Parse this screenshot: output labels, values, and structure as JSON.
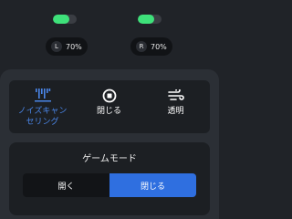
{
  "earbuds": {
    "left": {
      "label": "L",
      "battery_text": "70%",
      "battery_level": 0.7
    },
    "right": {
      "label": "R",
      "battery_text": "70%",
      "battery_level": 0.7
    }
  },
  "colors": {
    "battery_fill": "#3ee17a",
    "accent": "#2f6fe0",
    "active_text": "#4a86e8"
  },
  "anc_modes": {
    "items": [
      {
        "icon": "noise-cancel-icon",
        "label_line1": "ノイズキャン",
        "label_line2": "セリング",
        "active": true
      },
      {
        "icon": "stop-icon",
        "label": "閉じる",
        "active": false
      },
      {
        "icon": "transparency-icon",
        "label": "透明",
        "active": false
      }
    ]
  },
  "game_mode": {
    "title": "ゲームモード",
    "options": [
      {
        "label": "開く",
        "selected": false
      },
      {
        "label": "閉じる",
        "selected": true
      }
    ]
  }
}
